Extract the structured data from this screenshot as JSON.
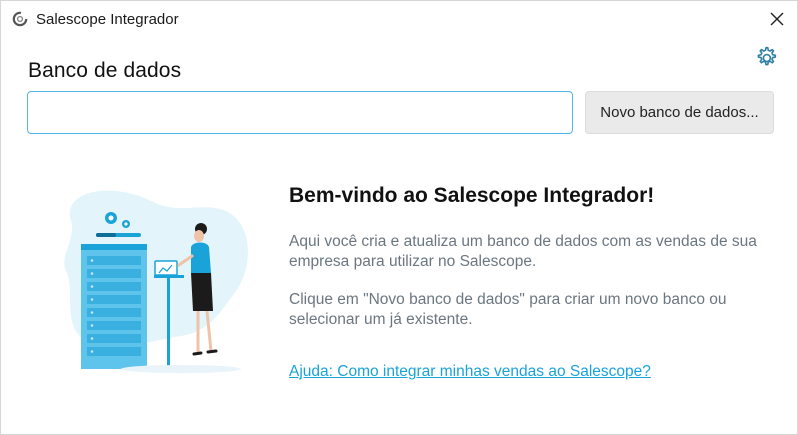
{
  "window": {
    "title": "Salescope Integrador",
    "close_icon": "close-icon",
    "app_icon": "salescope-logo-icon"
  },
  "header": {
    "settings_icon": "gear-icon"
  },
  "database": {
    "section_title": "Banco de dados",
    "input_value": "",
    "input_placeholder": "",
    "new_button_label": "Novo banco de dados..."
  },
  "welcome": {
    "title": "Bem-vindo ao Salescope Integrador!",
    "paragraph_1": "Aqui você cria e atualiza um banco de dados com as vendas de sua empresa para utilizar no Salescope.",
    "paragraph_2": "Clique em \"Novo banco de dados\" para criar um novo banco ou selecionar um já existente.",
    "help_link": "Ajuda: Como integrar minhas vendas ao Salescope?"
  },
  "colors": {
    "accent": "#1aa3d9",
    "illustration_blue": "#5ec4ec",
    "illustration_bg": "#e3f4fb",
    "text_muted": "#6b7680"
  }
}
